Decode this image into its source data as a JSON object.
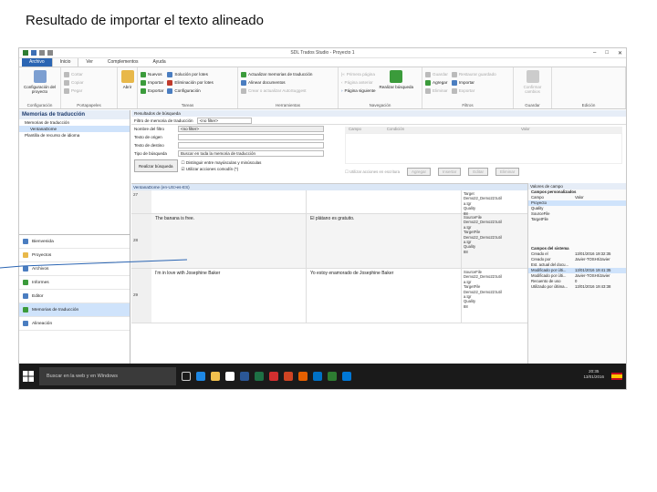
{
  "caption": "Resultado de importar el texto alineado",
  "window": {
    "title": "SDL Trados Studio - Proyecto 1",
    "min": "–",
    "max": "□",
    "close": "✕"
  },
  "menu": [
    {
      "label": "Archivo",
      "cls": "file"
    },
    {
      "label": "Inicio",
      "cls": "active"
    },
    {
      "label": "Ver",
      "cls": ""
    },
    {
      "label": "Complementos",
      "cls": ""
    },
    {
      "label": "Ayuda",
      "cls": ""
    }
  ],
  "ribbon": {
    "config": {
      "big": "Configuración del proyecto",
      "label": "Configuración"
    },
    "clipboard": {
      "items": [
        "Cortar",
        "Copiar",
        "Pegar"
      ],
      "label": "Portapapeles"
    },
    "open": {
      "big": "Abrir"
    },
    "tasks": {
      "items": [
        "Nuevos",
        "Importar",
        "Exportar"
      ],
      "items2": [
        "Solución por lotes",
        "Eliminación por lotes",
        "Configuración"
      ],
      "label": "Tareas"
    },
    "tools": {
      "items": [
        "Actualizar memorias de traducción",
        "Alinear documentos",
        "Crear o actualizar AutoSuggest"
      ],
      "label": "Herramientas"
    },
    "nav": {
      "items": [
        "Primera página",
        "Página anterior",
        "Página siguiente"
      ],
      "big": "Realizar búsqueda",
      "label": "Navegación"
    },
    "filters": {
      "items": [
        "Guardar",
        "Agregar",
        "Eliminar"
      ],
      "items2": [
        "Restaurar guardado",
        "Importar",
        "Exportar"
      ],
      "label": "Filtros"
    },
    "save": {
      "big": "Confirmar cambios",
      "label": "Guardar"
    },
    "edit": {
      "label": "Edición"
    }
  },
  "leftpane": {
    "title": "Memorias de traducción",
    "tree": [
      "Memorias de traducción",
      "VentanaDome",
      "Plantilla de recurso de idioma"
    ],
    "nav": [
      "Bienvenida",
      "Proyectos",
      "Archivos",
      "Informes",
      "Editor",
      "Memorias de traducción",
      "Alineación"
    ]
  },
  "search": {
    "header": "Resultados de búsqueda",
    "filterbar": "Filtro de memoria de traducción",
    "filtervalue": "<no filter>",
    "fields": [
      {
        "label": "Nombre del filtro",
        "value": "<no filter>"
      },
      {
        "label": "Texto de origen",
        "value": ""
      },
      {
        "label": "Texto de destino",
        "value": ""
      },
      {
        "label": "Tipo de búsqueda",
        "value": "Buscar en toda la memoria de traducción"
      }
    ],
    "run_button": "Realizar búsqueda",
    "check1": "Distinguir entre mayúsculas y minúsculas",
    "check2": "Utilizar acciones comodín (*)",
    "right_cols": [
      "Campo",
      "Condición",
      "Valor"
    ],
    "right_check": "Utilizar acciones en escritura",
    "right_buttons": [
      "Agregar",
      "Insertar",
      "Editar",
      "Eliminar"
    ]
  },
  "grid": {
    "header": "VentanaDome (en-US>es-ES)",
    "rows": [
      {
        "no": "27",
        "src": "",
        "tgt": "",
        "meta": [
          "Target",
          "Demo22_Demo22:tutil",
          "a.tgr",
          "Quality",
          "88"
        ]
      },
      {
        "no": "28",
        "src": "The banana is free.",
        "tgt": "El plátano es gratuito.",
        "meta": [
          "SourceFile",
          "Demo22_Demo22:tutil",
          "a.tgr",
          "TargetFile",
          "Demo22_Demo22:tutil",
          "a.tgr",
          "Quality",
          "88"
        ]
      },
      {
        "no": "29",
        "src": "I'm in love with Josephine Baker",
        "tgt": "Yo estoy enamorado de Josephine Baker",
        "meta": [
          "SourceFile",
          "Demo22_Demo22:tutil",
          "a.tgr",
          "TargetFile",
          "Demo22_Demo22:tutil",
          "a.tgr",
          "Quality",
          "88"
        ]
      }
    ]
  },
  "props": {
    "header": "Valores de campo",
    "custom_title": "Campos personalizados",
    "custom_cols": [
      "Campo",
      "Valor"
    ],
    "custom": [
      "Proyecto",
      "Quality",
      "SourceFile",
      "TargetFile"
    ],
    "system_title": "Campos del sistema",
    "system": [
      {
        "k": "Creado el",
        "v": "13/01/2016 19:32:35"
      },
      {
        "k": "Creado por",
        "v": "Javier-TOSHI/Javier"
      },
      {
        "k": "Est. actual del docu...",
        "v": ""
      },
      {
        "k": "Modificado por últi...",
        "v": "13/01/2016 19:41:35"
      },
      {
        "k": "Modificado por últi...",
        "v": "Javier-TOSHI/Javier"
      },
      {
        "k": "Recuento de uso",
        "v": "0"
      },
      {
        "k": "Utilizado por última...",
        "v": "13/01/2016 19:43:38"
      }
    ]
  },
  "taskbar": {
    "search": "Buscar en la web y en Windows",
    "time": "20:35",
    "date": "13/01/2016"
  },
  "colors": {
    "accent": "#2b65b3",
    "highlight": "#cfe3fb",
    "pointer": "#2b65b3"
  }
}
